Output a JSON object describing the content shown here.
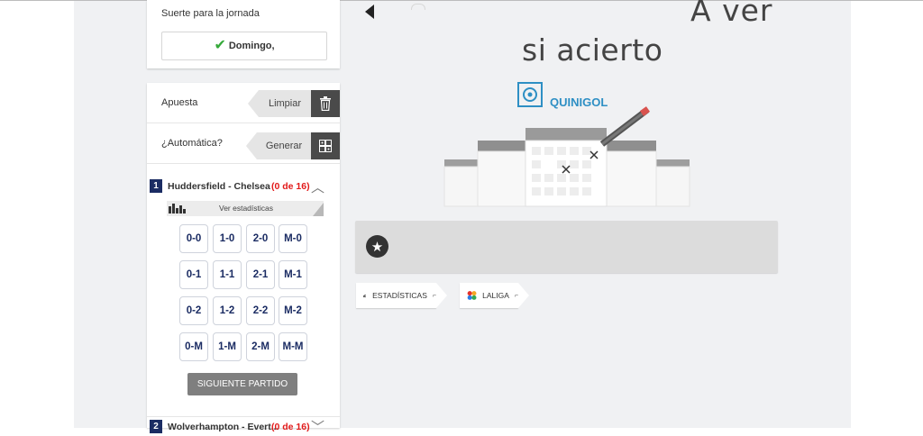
{
  "suerte": {
    "title": "Suerte para la jornada",
    "day": "Domingo,"
  },
  "apuesta": {
    "label": "Apuesta",
    "button": "Limpiar",
    "icon": "trash-icon"
  },
  "automatica": {
    "label": "¿Automática?",
    "button": "Generar",
    "icon": "dice-icon"
  },
  "match1": {
    "number": "1",
    "name": "Huddersfield - Chelsea",
    "count": "(0 de 16)",
    "stats_label": "Ver estadísticas",
    "scores": [
      "0-0",
      "1-0",
      "2-0",
      "M-0",
      "0-1",
      "1-1",
      "2-1",
      "M-1",
      "0-2",
      "1-2",
      "2-2",
      "M-2",
      "0-M",
      "1-M",
      "2-M",
      "M-M"
    ],
    "next_button": "SIGUIENTE PARTIDO"
  },
  "match2": {
    "number": "2",
    "name": "Wolverhampton - Evert...",
    "count": "(0 de 16)"
  },
  "main": {
    "heading_line1": "A ver",
    "heading_line2": "si acierto",
    "logo_text": "QUINIGOL"
  },
  "links": {
    "estadisticas": "ESTADÍSTICAS",
    "laliga": "LALIGA",
    "external": "⌐"
  },
  "colors": {
    "accent_navy": "#1b2c63",
    "count_red": "#e21a1a",
    "check_green": "#35a93a",
    "quinigol_blue": "#2e8fc4"
  }
}
